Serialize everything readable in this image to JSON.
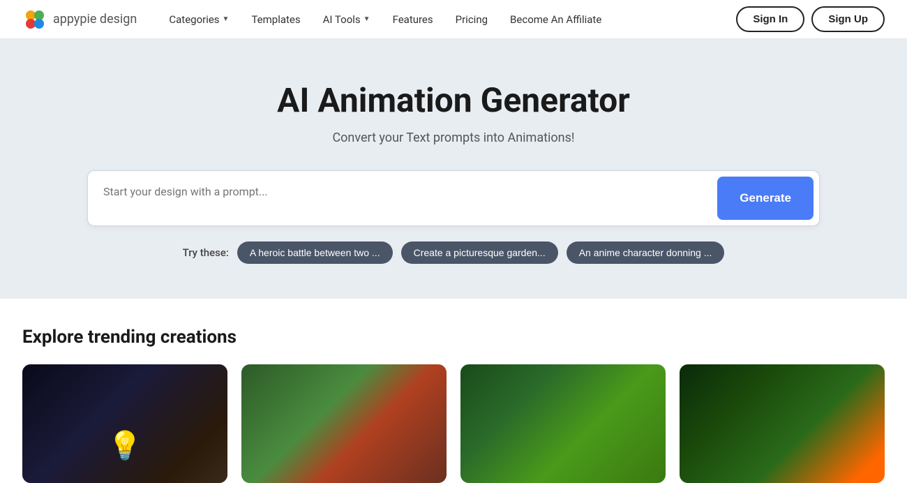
{
  "brand": {
    "name_part1": "appypie",
    "name_part2": " design"
  },
  "navbar": {
    "categories_label": "Categories",
    "templates_label": "Templates",
    "ai_tools_label": "AI Tools",
    "features_label": "Features",
    "pricing_label": "Pricing",
    "affiliate_label": "Become An Affiliate",
    "sign_in_label": "Sign In",
    "sign_up_label": "Sign Up"
  },
  "hero": {
    "title": "AI Animation Generator",
    "subtitle": "Convert your Text prompts into Animations!",
    "prompt_placeholder": "Start your design with a prompt...",
    "generate_label": "Generate",
    "try_these_label": "Try these:",
    "chips": [
      {
        "label": "A heroic battle between two ..."
      },
      {
        "label": "Create a picturesque garden..."
      },
      {
        "label": "An anime character donning ..."
      }
    ]
  },
  "trending": {
    "title": "Explore trending creations",
    "cards": [
      {
        "id": "card-1",
        "alt": "Dark scene with light bulb"
      },
      {
        "id": "card-2",
        "alt": "Green forest with red building"
      },
      {
        "id": "card-3",
        "alt": "Lush green nature scene"
      },
      {
        "id": "card-4",
        "alt": "Dark green with orange accent"
      }
    ]
  }
}
